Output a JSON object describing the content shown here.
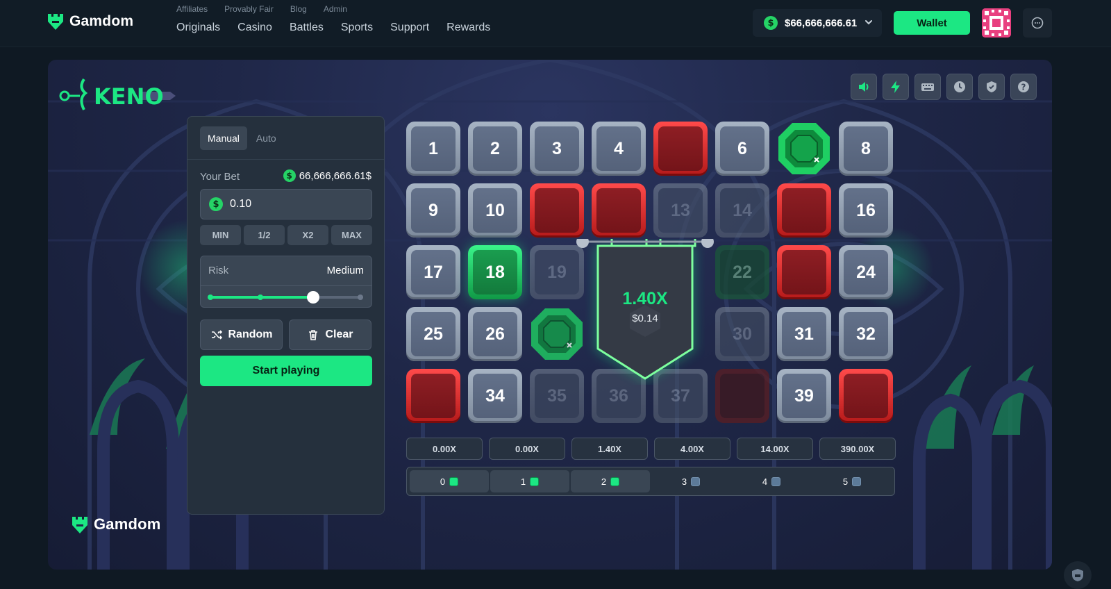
{
  "brand": {
    "name": "Gamdom"
  },
  "nav": {
    "secondary": [
      "Affiliates",
      "Provably Fair",
      "Blog",
      "Admin"
    ],
    "primary": [
      "Originals",
      "Casino",
      "Battles",
      "Sports",
      "Support",
      "Rewards"
    ]
  },
  "account": {
    "balance": "$66,666,666.61",
    "wallet_label": "Wallet"
  },
  "game": {
    "title": "KENO",
    "tabs": [
      "Manual",
      "Auto"
    ],
    "active_tab": "Manual",
    "bet_label": "Your Bet",
    "bet_max_display": "66,666,666.61$",
    "bet_value": "0.10",
    "quick": [
      "MIN",
      "1/2",
      "X2",
      "MAX"
    ],
    "risk_label": "Risk",
    "risk_value": "Medium",
    "risk_level_fraction": 0.67,
    "random_label": "Random",
    "clear_label": "Clear",
    "start_label": "Start playing",
    "banner": {
      "multiplier": "1.40X",
      "amount": "$0.14"
    },
    "payouts": [
      "0.00X",
      "0.00X",
      "1.40X",
      "4.00X",
      "14.00X",
      "390.00X"
    ],
    "hits": [
      {
        "label": "0",
        "state": "on"
      },
      {
        "label": "1",
        "state": "on"
      },
      {
        "label": "2",
        "state": "on"
      },
      {
        "label": "3",
        "state": "off"
      },
      {
        "label": "4",
        "state": "off"
      },
      {
        "label": "5",
        "state": "off"
      }
    ],
    "tiles": [
      {
        "n": "1",
        "s": "normal"
      },
      {
        "n": "2",
        "s": "normal"
      },
      {
        "n": "3",
        "s": "normal"
      },
      {
        "n": "4",
        "s": "normal"
      },
      {
        "n": "",
        "s": "red"
      },
      {
        "n": "6",
        "s": "normal"
      },
      {
        "n": "",
        "s": "gem"
      },
      {
        "n": "8",
        "s": "normal"
      },
      {
        "n": "9",
        "s": "normal"
      },
      {
        "n": "10",
        "s": "normal"
      },
      {
        "n": "",
        "s": "red"
      },
      {
        "n": "",
        "s": "red"
      },
      {
        "n": "13",
        "s": "dim"
      },
      {
        "n": "14",
        "s": "dim"
      },
      {
        "n": "",
        "s": "red"
      },
      {
        "n": "16",
        "s": "normal"
      },
      {
        "n": "17",
        "s": "normal"
      },
      {
        "n": "18",
        "s": "green"
      },
      {
        "n": "19",
        "s": "dim"
      },
      {
        "n": "",
        "s": "hidden"
      },
      {
        "n": "",
        "s": "hidden"
      },
      {
        "n": "22",
        "s": "greendim"
      },
      {
        "n": "",
        "s": "red"
      },
      {
        "n": "24",
        "s": "normal"
      },
      {
        "n": "25",
        "s": "normal"
      },
      {
        "n": "26",
        "s": "normal"
      },
      {
        "n": "",
        "s": "gem"
      },
      {
        "n": "",
        "s": "hidden"
      },
      {
        "n": "",
        "s": "hidden"
      },
      {
        "n": "30",
        "s": "dim"
      },
      {
        "n": "31",
        "s": "normal"
      },
      {
        "n": "32",
        "s": "normal"
      },
      {
        "n": "",
        "s": "red"
      },
      {
        "n": "34",
        "s": "normal"
      },
      {
        "n": "35",
        "s": "dim"
      },
      {
        "n": "36",
        "s": "dim"
      },
      {
        "n": "37",
        "s": "dim"
      },
      {
        "n": "",
        "s": "reddim"
      },
      {
        "n": "39",
        "s": "normal"
      },
      {
        "n": "",
        "s": "red"
      }
    ]
  },
  "colors": {
    "accent": "#1ce783",
    "bg": "#0f1923",
    "panel": "#25303d",
    "red": "#d62a2a"
  },
  "icons": [
    "volume-icon",
    "lightning-icon",
    "keyboard-icon",
    "history-icon",
    "shield-icon",
    "help-icon"
  ]
}
